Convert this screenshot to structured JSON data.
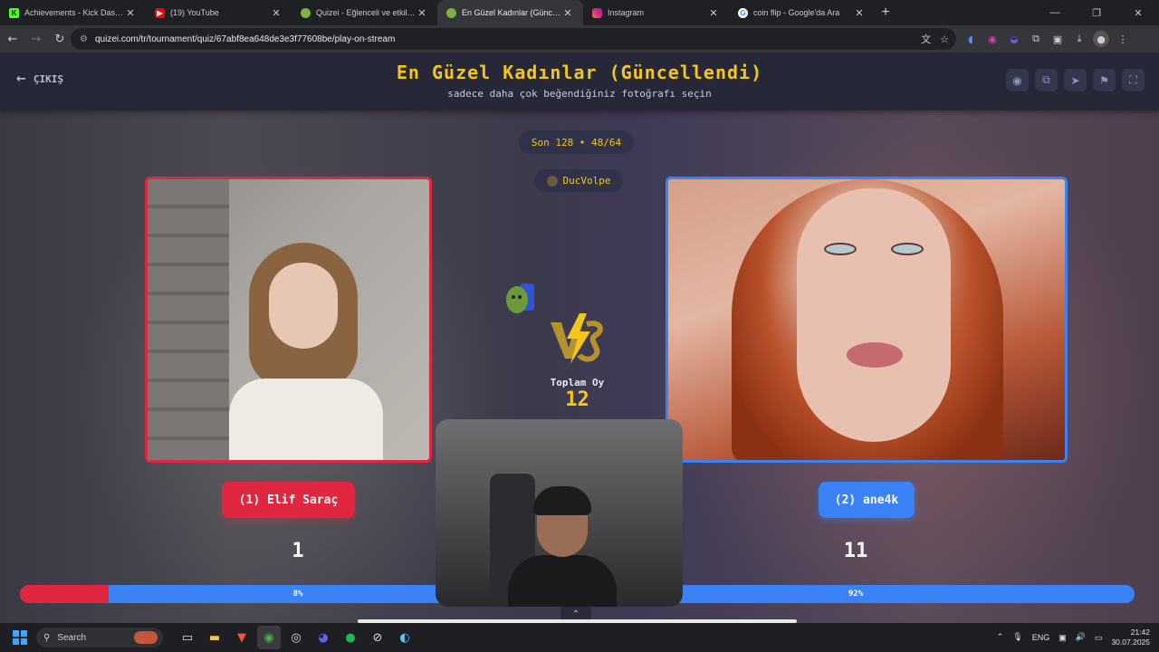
{
  "browser": {
    "tabs": [
      {
        "label": "Achievements - Kick Dashboard",
        "icon": "kick-icon",
        "color": "#53fc18"
      },
      {
        "label": "(19) YouTube",
        "icon": "youtube-icon",
        "color": "#ff0000"
      },
      {
        "label": "Quizei - Eğlenceli ve etkileşimli",
        "icon": "quizei-icon",
        "color": "#7cb342"
      },
      {
        "label": "En Güzel Kadınlar (Güncellendi)",
        "icon": "quizei-icon",
        "color": "#7cb342"
      },
      {
        "label": "Instagram",
        "icon": "instagram-icon",
        "color": "#e1306c"
      },
      {
        "label": "coin flip - Google'da Ara",
        "icon": "google-icon",
        "color": "#4285f4"
      }
    ],
    "url": "quizei.com/tr/tournament/quiz/67abf8ea648de3e3f77608be/play-on-stream"
  },
  "header": {
    "exit_label": "ÇIKIŞ",
    "title": "En Güzel Kadınlar (Güncellendi)",
    "subtitle": "sadece daha çok beğendiğiniz fotoğrafı seçin"
  },
  "round": {
    "label": "Son 128 • 48/64"
  },
  "streamer": {
    "name": "DucVolpe"
  },
  "total": {
    "label": "Toplam Oy",
    "value": "12"
  },
  "left": {
    "name": "(1) Elif Saraç",
    "votes": "1",
    "percent_label": "8%",
    "percent": 8
  },
  "right": {
    "name": "(2) ane4k",
    "votes": "11",
    "percent_label": "92%"
  },
  "colors": {
    "accent": "#f5c518",
    "left": "#e0273f",
    "right": "#3b82f6"
  },
  "taskbar": {
    "search_label": "Search",
    "lang": "ENG",
    "time": "21:42",
    "date": "30.07.2025"
  }
}
